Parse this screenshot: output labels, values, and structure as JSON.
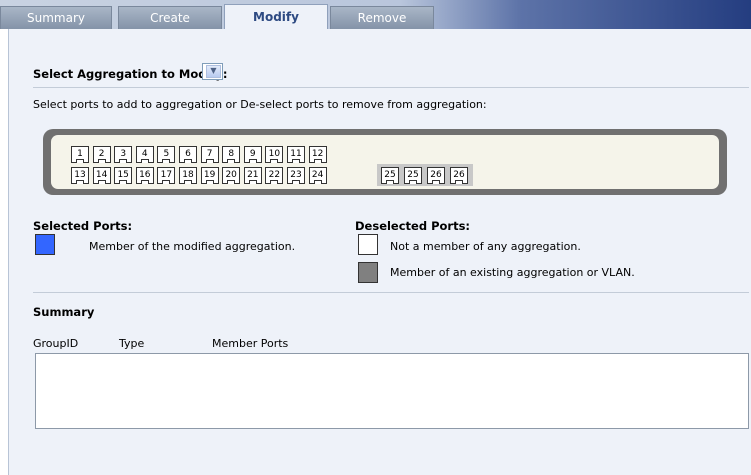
{
  "tabs": [
    {
      "label": "Summary",
      "active": false
    },
    {
      "label": "Create",
      "active": false
    },
    {
      "label": "Modify",
      "active": true
    },
    {
      "label": "Remove",
      "active": false
    }
  ],
  "select_aggregation": {
    "label": "Select Aggregation to Modify:",
    "selected_value": ""
  },
  "instructions": "Select ports to add to aggregation or De-select ports to remove from aggregation:",
  "ports": {
    "row1": [
      "1",
      "2",
      "3",
      "4",
      "5",
      "6",
      "7",
      "8",
      "9",
      "10",
      "11",
      "12"
    ],
    "row2": [
      "13",
      "14",
      "15",
      "16",
      "17",
      "18",
      "19",
      "20",
      "21",
      "22",
      "23",
      "24"
    ],
    "sfp": [
      "25",
      "25",
      "26",
      "26"
    ]
  },
  "legend": {
    "selected_title": "Selected Ports:",
    "selected_member": "Member of the modified aggregation.",
    "deselected_title": "Deselected Ports:",
    "not_member": "Not a member of any aggregation.",
    "existing_member": "Member of an existing aggregation or VLAN."
  },
  "summary": {
    "title": "Summary",
    "columns": [
      "GroupID",
      "Type",
      "Member Ports"
    ],
    "rows": []
  },
  "colors": {
    "selected": "#3366ff",
    "not_member": "#ffffff",
    "existing_member": "#808080",
    "active_tab_text": "#2d4a82"
  }
}
